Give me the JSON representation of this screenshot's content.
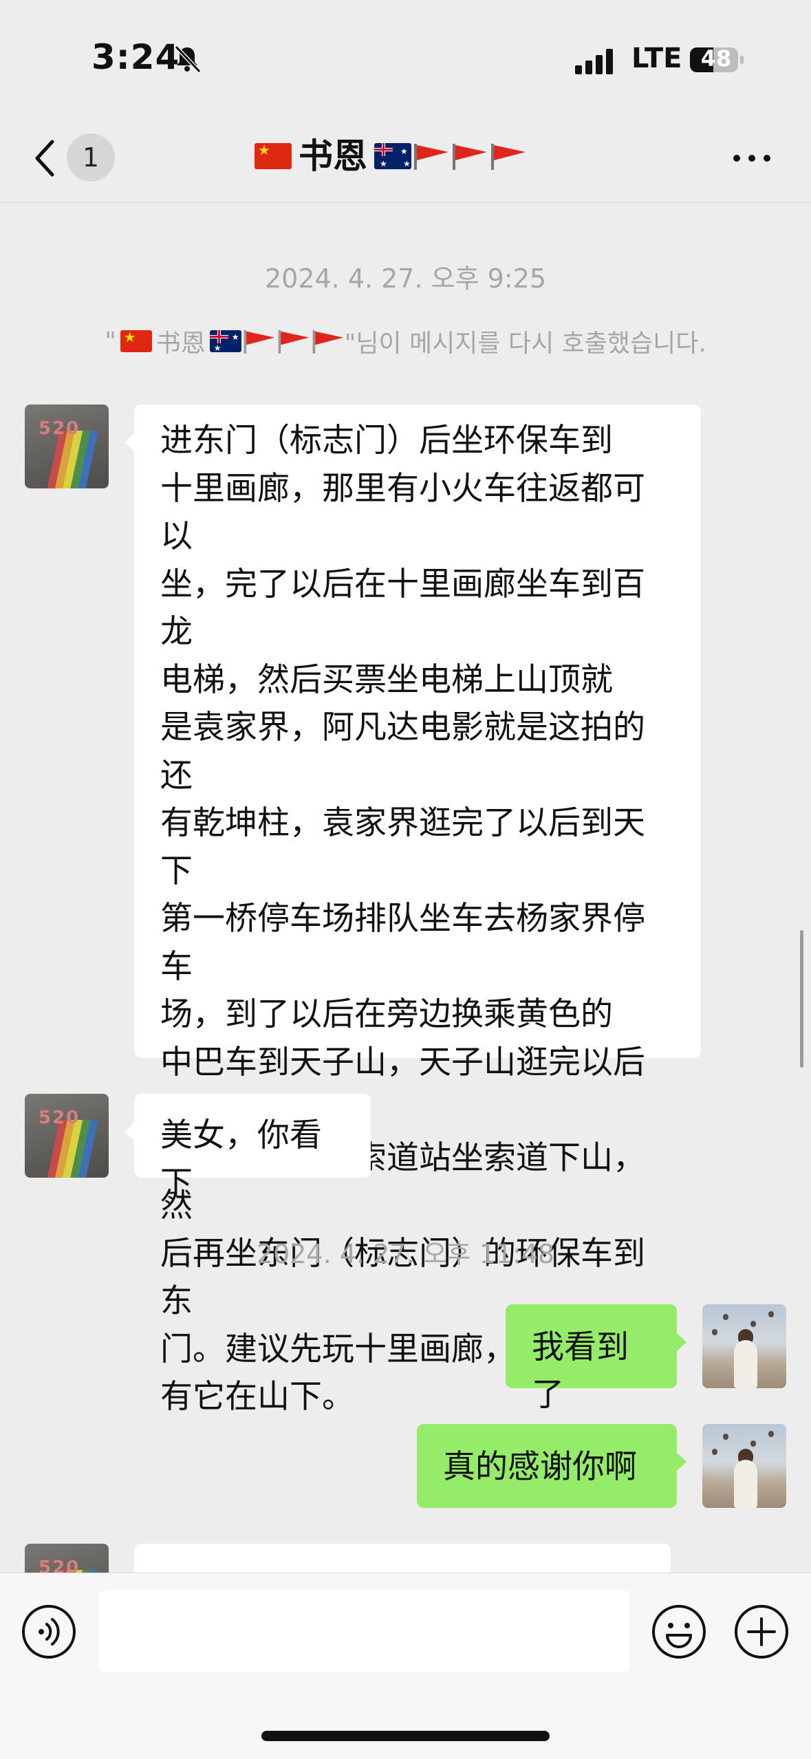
{
  "status_bar": {
    "time": "3:24",
    "network": "LTE",
    "battery": "48",
    "icons": [
      "bell-slash-icon",
      "signal-icon",
      "battery-icon"
    ]
  },
  "nav": {
    "unread_count": "1",
    "contact_name": "书恩",
    "icons": [
      "chevron-left-icon",
      "more-icon"
    ]
  },
  "chat": {
    "timestamp_1": "2024. 4. 27. 오후 9:25",
    "system_quote_open": "\"",
    "system_name": "书恩",
    "system_text": "\"님이 메시지를 다시 호출했습니다.",
    "msg_1_lines": [
      "进东门（标志门）后坐环保车到",
      "十里画廊，那里有小火车往返都可以",
      "坐，完了以后在十里画廊坐车到百龙",
      "电梯，然后买票坐电梯上山顶就",
      "是袁家界，阿凡达电影就是这拍的还",
      "有乾坤柱，袁家界逛完了以后到天下",
      "第一桥停车场排队坐车去杨家界停车",
      "场，到了以后在旁边换乘黄色的",
      "中巴车到天子山，天子山逛完以后再",
      "坐车去天子山索道站坐索道下山，然",
      "后再坐东门（标志门）的环保车到东",
      "门。建议先玩十里画廊，因为只",
      "有它在山下。"
    ],
    "msg_2": "美女，你看下",
    "timestamp_2": "2024. 4. 27. 오후 11:48",
    "msg_3": "我看到了",
    "msg_4": "真的感谢你啊"
  },
  "colors": {
    "background": "#ededed",
    "sent_bubble": "#95ec69",
    "received_bubble": "#ffffff",
    "timestamp_text": "#a6a6a6"
  },
  "input_bar": {
    "icons": [
      "voice-icon",
      "emoji-icon",
      "plus-icon"
    ]
  }
}
